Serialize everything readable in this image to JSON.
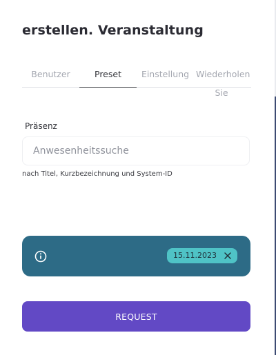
{
  "dialog": {
    "title": "erstellen. Veranstaltung"
  },
  "tabs": [
    {
      "label": "Benutzer",
      "active": false
    },
    {
      "label": "Preset",
      "active": true
    },
    {
      "label": "Einstellung",
      "active": false
    },
    {
      "label_line1": "Wiederholen",
      "label_line2": "Sie",
      "active": false
    }
  ],
  "presence": {
    "label": "Präsenz",
    "placeholder": "Anwesenheitssuche",
    "value": "",
    "hint": "nach Titel, Kurzbezeichnung und System-ID"
  },
  "info_bar": {
    "icon": "info-icon",
    "date_chip": "15.11.2023",
    "chip_remove_icon": "close-icon"
  },
  "actions": {
    "request_label": "REQUEST"
  },
  "colors": {
    "accent_button": "#6249c5",
    "info_bar_bg": "#2d6b86",
    "date_chip_bg": "#4fc3c6",
    "text_primary": "#2b2b33"
  }
}
